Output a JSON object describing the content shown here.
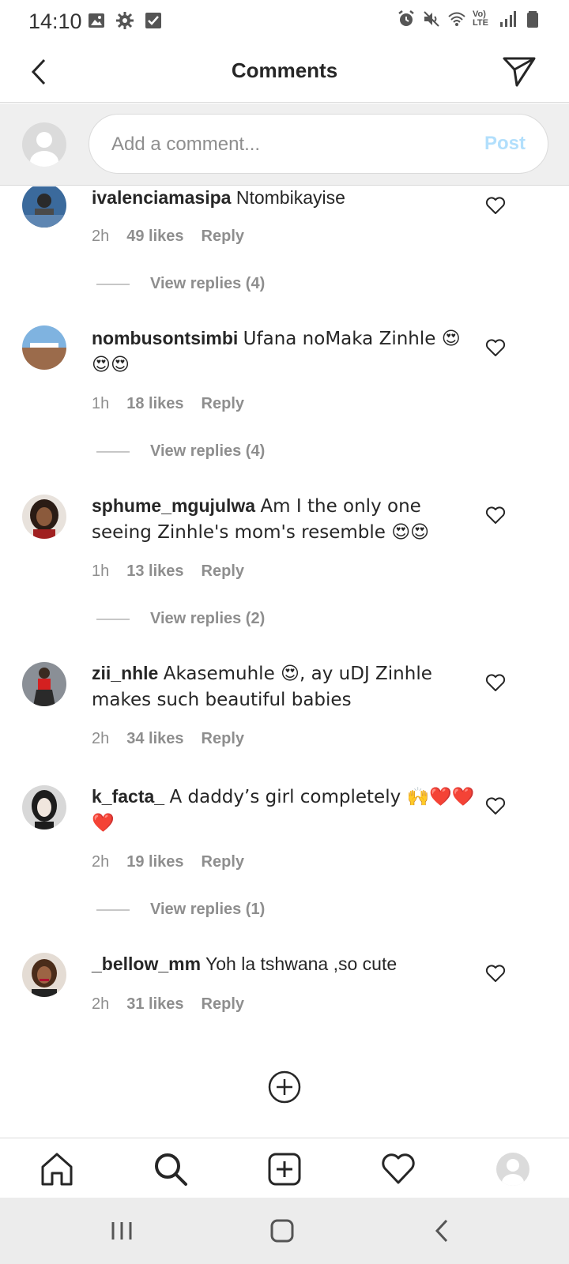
{
  "status_bar": {
    "time": "14:10",
    "left_icons": [
      "image-icon",
      "settings-icon",
      "checkbox-icon"
    ],
    "right_icons": [
      "alarm-icon",
      "mute-icon",
      "wifi-icon",
      "volte-icon",
      "signal-icon",
      "battery-icon"
    ],
    "volte_label": "Vo) LTE"
  },
  "header": {
    "title": "Comments"
  },
  "compose": {
    "placeholder": "Add a comment...",
    "post_label": "Post"
  },
  "comments": [
    {
      "username": "ivalenciamasipa",
      "text": "Ntombikayise",
      "time": "2h",
      "likes": "49 likes",
      "reply": "Reply",
      "replies": "View replies (4)"
    },
    {
      "username": "nombusontsimbi",
      "text": "Ufana noMaka Zinhle 😍😍😍",
      "time": "1h",
      "likes": "18 likes",
      "reply": "Reply",
      "replies": "View replies (4)"
    },
    {
      "username": "sphume_mgujulwa",
      "text": "Am I the only one seeing Zinhle's mom's resemble 😍😍",
      "time": "1h",
      "likes": "13 likes",
      "reply": "Reply",
      "replies": "View replies (2)"
    },
    {
      "username": "zii_nhle",
      "text": "Akasemuhle 😍, ay uDJ Zinhle makes such beautiful babies",
      "time": "2h",
      "likes": "34 likes",
      "reply": "Reply",
      "replies": ""
    },
    {
      "username": "k_facta_",
      "text": "A daddy’s girl completely 🙌❤️❤️❤️",
      "time": "2h",
      "likes": "19 likes",
      "reply": "Reply",
      "replies": "View replies (1)"
    },
    {
      "username": "_bellow_mm",
      "text": "Yoh la tshwana ,so cute",
      "time": "2h",
      "likes": "31 likes",
      "reply": "Reply",
      "replies": ""
    }
  ],
  "bottom_nav": [
    "home-icon",
    "search-icon",
    "new-post-icon",
    "activity-heart-icon",
    "profile-avatar"
  ],
  "system_nav": [
    "recent-apps-icon",
    "home-button-icon",
    "back-button-icon"
  ],
  "colors": {
    "text": "#262626",
    "secondary_text": "#8e8e8e",
    "post_disabled": "#b2dffc",
    "divider": "#dbdbdb",
    "compose_bg": "#efefef"
  }
}
